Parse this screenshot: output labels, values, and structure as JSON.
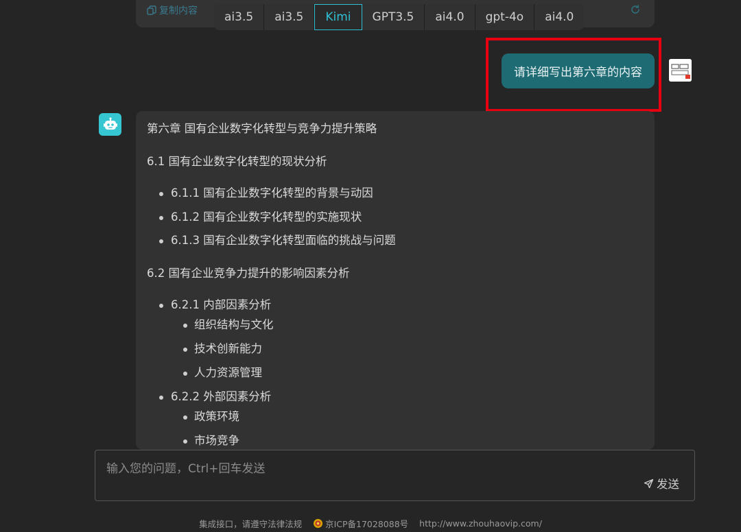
{
  "previous_message": {
    "copy_label": "复制内容"
  },
  "model_tabs": [
    {
      "label": "ai3.5",
      "active": false
    },
    {
      "label": "ai3.5",
      "active": false
    },
    {
      "label": "Kimi",
      "active": true
    },
    {
      "label": "GPT3.5",
      "active": false
    },
    {
      "label": "ai4.0",
      "active": false
    },
    {
      "label": "gpt-4o",
      "active": false
    },
    {
      "label": "ai4.0",
      "active": false
    }
  ],
  "user_message": {
    "text": "请详细写出第六章的内容"
  },
  "answer": {
    "title": "第六章 国有企业数字化转型与竞争力提升策略",
    "section1": {
      "heading": "6.1 国有企业数字化转型的现状分析",
      "items": [
        "6.1.1 国有企业数字化转型的背景与动因",
        "6.1.2 国有企业数字化转型的实施现状",
        "6.1.3 国有企业数字化转型面临的挑战与问题"
      ]
    },
    "section2": {
      "heading": "6.2 国有企业竞争力提升的影响因素分析",
      "internal": {
        "label": "6.2.1 内部因素分析",
        "items": [
          "组织结构与文化",
          "技术创新能力",
          "人力资源管理"
        ]
      },
      "external": {
        "label": "6.2.2 外部因素分析",
        "items": [
          "政策环境",
          "市场竞争"
        ]
      }
    }
  },
  "input": {
    "placeholder": "输入您的问题，Ctrl+回车发送",
    "value": "",
    "send_label": "发送"
  },
  "footer": {
    "notice": "集成接口，请遵守法律法规",
    "icp": "京ICP备17028088号",
    "url": "http://www.zhouhaovip.com/"
  },
  "colors": {
    "accent": "#2fc1d3",
    "user_bubble": "#1f6b73",
    "bot_avatar": "#35c6d1",
    "highlight": "#e60012"
  }
}
